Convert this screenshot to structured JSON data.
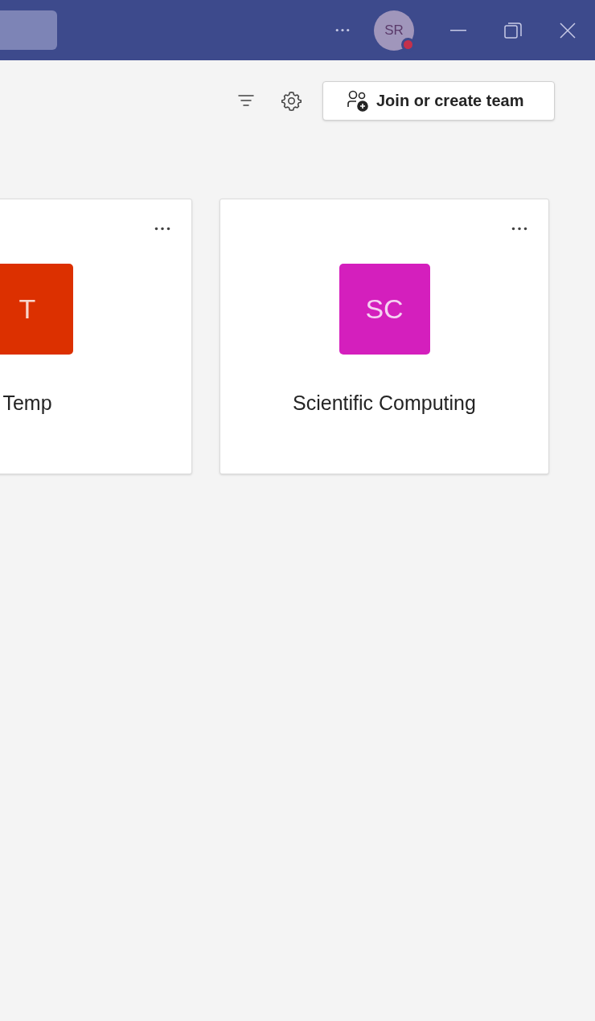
{
  "title_bar": {
    "avatar": {
      "initials": "SR",
      "status": {
        "color": "#c4314b"
      }
    }
  },
  "toolbar": {
    "join_button": "Join or create team"
  },
  "teams": [
    {
      "initials": "T",
      "name": "Temp",
      "color": "#dc3000"
    },
    {
      "initials": "SC",
      "name": "Scientific Computing",
      "color": "#d41fbd"
    }
  ]
}
